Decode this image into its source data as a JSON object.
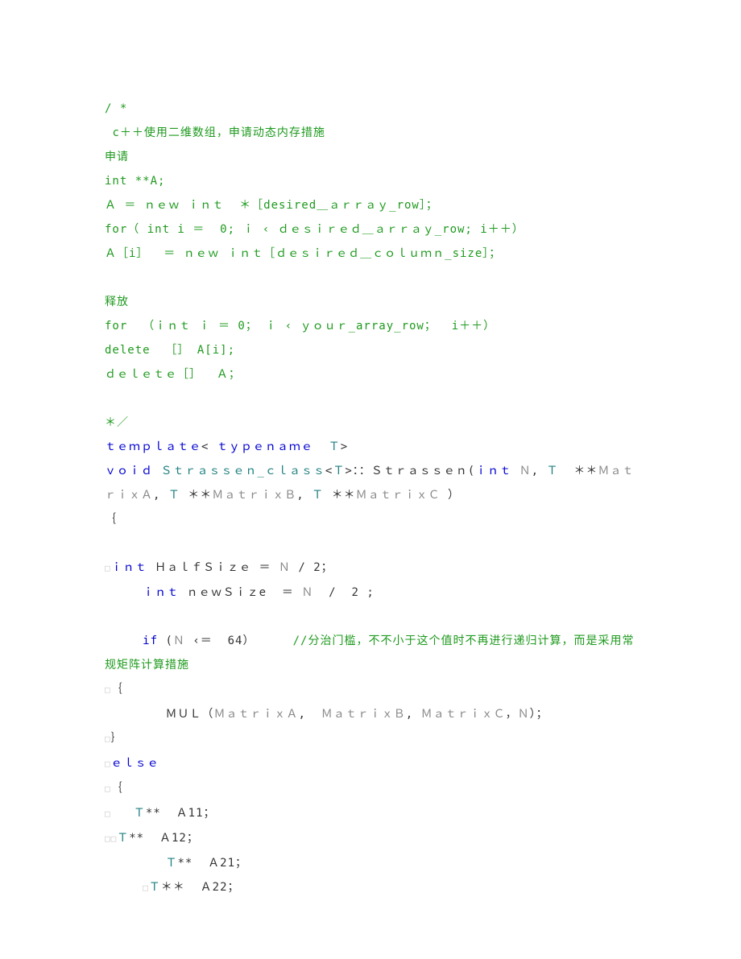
{
  "lines": [
    [
      {
        "cls": "c-green",
        "t": "/ *"
      }
    ],
    [
      {
        "cls": "c-green",
        "t": " c＋＋使用二维数组，申请动态内存措施"
      }
    ],
    [
      {
        "cls": "c-green",
        "t": "申请"
      }
    ],
    [
      {
        "cls": "c-green",
        "t": "int **A;"
      }
    ],
    [
      {
        "cls": "c-green",
        "t": "Ａ ＝ ｎｅｗ ｉｎｔ  ＊［desired＿ａｒｒａｙ_row］；"
      }
    ],
    [
      {
        "cls": "c-green",
        "t": "for（ int i ＝  0; ｉ ‹ ｄｅｓｉｒｅｄ＿ａｒｒａｙ_row; i＋＋）"
      }
    ],
    [
      {
        "cls": "c-green",
        "t": "Ａ［i］  ＝ ｎｅｗ ｉｎｔ［ｄｅｓｉｒｅｄ＿ｃｏｌｕｍｎ_size］；"
      }
    ],
    [
      {
        "cls": "c-green",
        "t": " "
      }
    ],
    [
      {
        "cls": "c-green",
        "t": "释放"
      }
    ],
    [
      {
        "cls": "c-green",
        "t": "for  （ｉｎｔ ｉ ＝ 0； ｉ ‹ ｙｏｕｒ_array_row；  i＋＋）"
      }
    ],
    [
      {
        "cls": "c-green",
        "t": "delete  ［］ A[i];"
      }
    ],
    [
      {
        "cls": "c-green",
        "t": "ｄｅｌｅｔｅ［］  Ａ；"
      }
    ],
    [
      {
        "cls": "c-green",
        "t": " "
      }
    ],
    [
      {
        "cls": "c-green",
        "t": "＊／"
      }
    ],
    [
      {
        "cls": "c-blue",
        "t": "ｔｅｍｐｌａｔｅ"
      },
      {
        "cls": "c-black",
        "t": "< "
      },
      {
        "cls": "c-blue",
        "t": "ｔｙｐｅｎａｍｅ"
      },
      {
        "cls": "c-black",
        "t": "  "
      },
      {
        "cls": "c-teal",
        "t": "Ｔ"
      },
      {
        "cls": "c-black",
        "t": ">"
      }
    ],
    [
      {
        "cls": "c-blue",
        "t": "ｖｏｉｄ "
      },
      {
        "cls": "c-teal",
        "t": "Ｓｔｒａｓｓｅｎ_ｃｌａｓｓ"
      },
      {
        "cls": "c-black",
        "t": "<"
      },
      {
        "cls": "c-teal",
        "t": "Ｔ"
      },
      {
        "cls": "c-black",
        "t": ">：：Ｓｔｒａｓｓｅｎ("
      },
      {
        "cls": "c-blue",
        "t": "ｉｎｔ "
      },
      {
        "cls": "c-gray",
        "t": "Ｎ"
      },
      {
        "cls": "c-black",
        "t": ", "
      },
      {
        "cls": "c-teal",
        "t": "Ｔ  "
      },
      {
        "cls": "c-black",
        "t": "＊＊"
      },
      {
        "cls": "c-gray",
        "t": "ＭａｔｒｉｘＡ"
      },
      {
        "cls": "c-black",
        "t": ", "
      },
      {
        "cls": "c-teal",
        "t": "Ｔ "
      },
      {
        "cls": "c-black",
        "t": "＊＊"
      },
      {
        "cls": "c-gray",
        "t": "ＭａｔｒｉｘＢ"
      },
      {
        "cls": "c-black",
        "t": ", "
      },
      {
        "cls": "c-teal",
        "t": "Ｔ "
      },
      {
        "cls": "c-black",
        "t": "＊＊"
      },
      {
        "cls": "c-gray",
        "t": "ＭａｔｒｉｘＣ "
      },
      {
        "cls": "c-black",
        "t": "）"
      }
    ],
    [
      {
        "cls": "c-black",
        "t": "｛"
      }
    ],
    [
      {
        "cls": "c-black",
        "t": " "
      }
    ],
    [
      {
        "cls": "tab",
        "t": "□"
      },
      {
        "cls": "c-blue",
        "t": "ｉｎｔ "
      },
      {
        "cls": "c-black",
        "t": "ＨａｌｆＳｉｚｅ ＝ "
      },
      {
        "cls": "c-gray",
        "t": "Ｎ"
      },
      {
        "cls": "c-black",
        "t": " / 2；"
      }
    ],
    [
      {
        "cls": "c-black",
        "t": "     "
      },
      {
        "cls": "c-blue",
        "t": "ｉｎｔ "
      },
      {
        "cls": "c-black",
        "t": "ｎｅｗＳｉｚe  ＝ "
      },
      {
        "cls": "c-gray",
        "t": "Ｎ"
      },
      {
        "cls": "c-black",
        "t": "  /  2 ;"
      }
    ],
    [
      {
        "cls": "c-black",
        "t": " "
      }
    ],
    [
      {
        "cls": "c-black",
        "t": "     "
      },
      {
        "cls": "c-blue",
        "t": "if "
      },
      {
        "cls": "c-black",
        "t": "("
      },
      {
        "cls": "c-gray",
        "t": "Ｎ"
      },
      {
        "cls": "c-black",
        "t": " ‹＝  64）     "
      },
      {
        "cls": "c-green",
        "t": "//分治门槛，不不小于这个值时不再进行递归计算，而是采用常规矩阵计算措施"
      }
    ],
    [
      {
        "cls": "tab",
        "t": "□"
      },
      {
        "cls": "c-black",
        "t": "｛"
      }
    ],
    [
      {
        "cls": "c-black",
        "t": "        ＭＵＬ（"
      },
      {
        "cls": "c-gray",
        "t": "ＭａｔｒｉｘＡ"
      },
      {
        "cls": "c-black",
        "t": ",  "
      },
      {
        "cls": "c-gray",
        "t": "ＭａｔｒｉｘＢ"
      },
      {
        "cls": "c-black",
        "t": ", "
      },
      {
        "cls": "c-gray",
        "t": "ＭａｔｒｉｘＣ"
      },
      {
        "cls": "c-black",
        "t": "，"
      },
      {
        "cls": "c-gray",
        "t": "Ｎ"
      },
      {
        "cls": "c-black",
        "t": "）；"
      }
    ],
    [
      {
        "cls": "tab",
        "t": "□"
      },
      {
        "cls": "c-black",
        "t": "｝"
      }
    ],
    [
      {
        "cls": "tab",
        "t": "□"
      },
      {
        "cls": "c-blue",
        "t": "ｅｌｓｅ"
      }
    ],
    [
      {
        "cls": "tab",
        "t": "□"
      },
      {
        "cls": "c-black",
        "t": "｛"
      }
    ],
    [
      {
        "cls": "tab",
        "t": "□"
      },
      {
        "cls": "c-black",
        "t": "   "
      },
      {
        "cls": "c-teal",
        "t": "Ｔ"
      },
      {
        "cls": "c-black",
        "t": "**  Ａ11；"
      }
    ],
    [
      {
        "cls": "tab",
        "t": "□□"
      },
      {
        "cls": "c-teal",
        "t": "Ｔ"
      },
      {
        "cls": "c-black",
        "t": "**  Ａ12；"
      }
    ],
    [
      {
        "cls": "c-black",
        "t": "        "
      },
      {
        "cls": "c-teal",
        "t": "Ｔ"
      },
      {
        "cls": "c-black",
        "t": "**  Ａ21；"
      }
    ],
    [
      {
        "cls": "c-black",
        "t": "     "
      },
      {
        "cls": "tab",
        "t": "□"
      },
      {
        "cls": "c-teal",
        "t": "Ｔ"
      },
      {
        "cls": "c-black",
        "t": "＊＊  Ａ22；"
      }
    ]
  ]
}
